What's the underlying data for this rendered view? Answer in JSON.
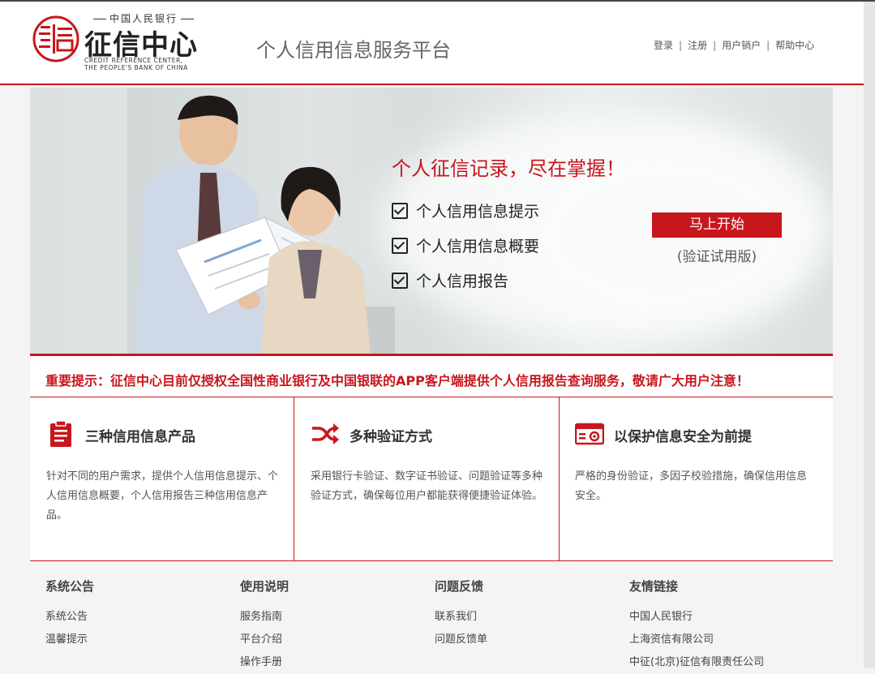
{
  "header": {
    "logo_top": "中国人民银行",
    "logo_name": "征信中心",
    "logo_en_line1": "CREDIT REFERENCE CENTER,",
    "logo_en_line2": "THE PEOPLE'S BANK OF CHINA",
    "platform_title": "个人信用信息服务平台",
    "nav": [
      {
        "label": "登录"
      },
      {
        "label": "注册"
      },
      {
        "label": "用户销户"
      },
      {
        "label": "帮助中心"
      }
    ]
  },
  "banner": {
    "headline": "个人征信记录，尽在掌握！",
    "checks": [
      "个人信用信息提示",
      "个人信用信息概要",
      "个人信用报告"
    ],
    "start_button": "马上开始",
    "trial_text": "(验证试用版)"
  },
  "notice": {
    "text": "重要提示：征信中心目前仅授权全国性商业银行及中国银联的APP客户端提供个人信用报告查询服务，敬请广大用户注意！"
  },
  "features": [
    {
      "icon": "clipboard-icon",
      "title": "三种信用信息产品",
      "desc": "针对不同的用户需求，提供个人信用信息提示、个人信用信息概要，个人信用报告三种信用信息产品。"
    },
    {
      "icon": "shuffle-icon",
      "title": "多种验证方式",
      "desc": "采用银行卡验证、数字证书验证、问题验证等多种验证方式，确保每位用户都能获得便捷验证体验。"
    },
    {
      "icon": "id-card-icon",
      "title": "以保护信息安全为前提",
      "desc": "严格的身份验证，多因子校验措施，确保信用信息安全。"
    }
  ],
  "footer": {
    "columns": [
      {
        "title": "系统公告",
        "links": [
          "系统公告",
          "温馨提示"
        ]
      },
      {
        "title": "使用说明",
        "links": [
          "服务指南",
          "平台介绍",
          "操作手册"
        ]
      },
      {
        "title": "问题反馈",
        "links": [
          "联系我们",
          "问题反馈单"
        ]
      },
      {
        "title": "友情链接",
        "links": [
          "中国人民银行",
          "上海资信有限公司",
          "中征(北京)征信有限责任公司"
        ]
      }
    ]
  },
  "colors": {
    "accent": "#c8161d",
    "text": "#333333",
    "muted": "#666666"
  }
}
